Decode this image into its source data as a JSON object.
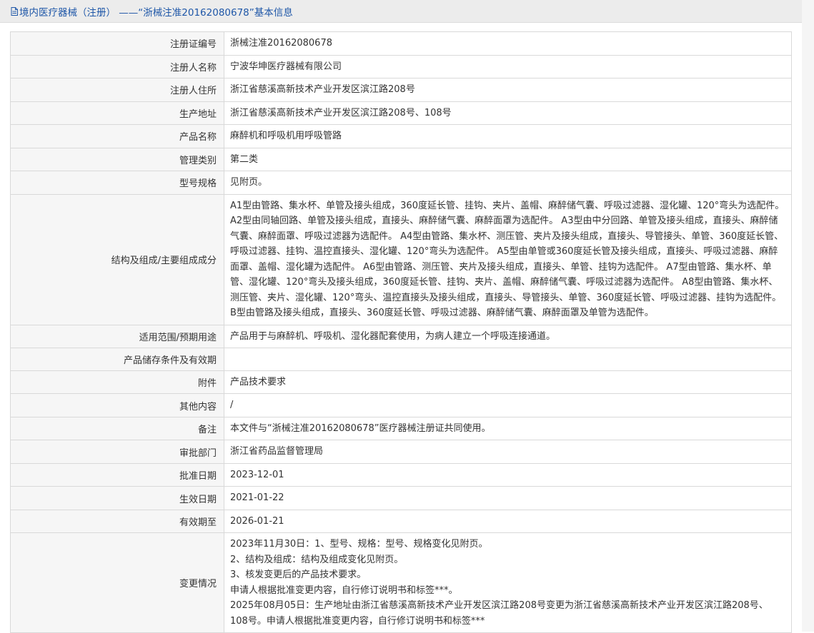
{
  "header": {
    "title": "境内医疗器械（注册） ——“浙械注准20162080678”基本信息"
  },
  "rows": [
    {
      "label": "注册证编号",
      "value": "浙械注准20162080678"
    },
    {
      "label": "注册人名称",
      "value": "宁波华坤医疗器械有限公司"
    },
    {
      "label": "注册人住所",
      "value": "浙江省慈溪高新技术产业开发区滨江路208号"
    },
    {
      "label": "生产地址",
      "value": "浙江省慈溪高新技术产业开发区滨江路208号、108号"
    },
    {
      "label": "产品名称",
      "value": "麻醉机和呼吸机用呼吸管路"
    },
    {
      "label": "管理类别",
      "value": "第二类"
    },
    {
      "label": "型号规格",
      "value": "见附页。"
    },
    {
      "label": "结构及组成/主要组成成分",
      "value": "A1型由管路、集水杯、单管及接头组成，360度延长管、挂钩、夹片、盖帽、麻醉储气囊、呼吸过滤器、湿化罐、120°弯头为选配件。 A2型由同轴回路、单管及接头组成，直接头、麻醉储气囊、麻醉面罩为选配件。 A3型由中分回路、单管及接头组成，直接头、麻醉储气囊、麻醉面罩、呼吸过滤器为选配件。 A4型由管路、集水杯、测压管、夹片及接头组成，直接头、导管接头、单管、360度延长管、呼吸过滤器、挂钩、温控直接头、湿化罐、120°弯头为选配件。 A5型由单管或360度延长管及接头组成，直接头、呼吸过滤器、麻醉面罩、盖帽、湿化罐为选配件。 A6型由管路、测压管、夹片及接头组成，直接头、单管、挂钩为选配件。 A7型由管路、集水杯、单管、湿化罐、120°弯头及接头组成，360度延长管、挂钩、夹片、盖帽、麻醉储气囊、呼吸过滤器为选配件。 A8型由管路、集水杯、测压管、夹片、湿化罐、120°弯头、温控直接头及接头组成，直接头、导管接头、单管、360度延长管、呼吸过滤器、挂钩为选配件。 B型由管路及接头组成，直接头、360度延长管、呼吸过滤器、麻醉储气囊、麻醉面罩及单管为选配件。"
    },
    {
      "label": "适用范围/预期用途",
      "value": "产品用于与麻醉机、呼吸机、湿化器配套使用，为病人建立一个呼吸连接通道。"
    },
    {
      "label": "产品储存条件及有效期",
      "value": ""
    },
    {
      "label": "附件",
      "value": "产品技术要求"
    },
    {
      "label": "其他内容",
      "value": "/"
    },
    {
      "label": "备注",
      "value": "本文件与“浙械注准20162080678”医疗器械注册证共同使用。"
    },
    {
      "label": "审批部门",
      "value": "浙江省药品监督管理局"
    },
    {
      "label": "批准日期",
      "value": "2023-12-01"
    },
    {
      "label": "生效日期",
      "value": "2021-01-22"
    },
    {
      "label": "有效期至",
      "value": "2026-01-21"
    }
  ],
  "change_row": {
    "label": "变更情况",
    "lines": [
      "2023年11月30日：1、型号、规格：型号、规格变化见附页。",
      "2、结构及组成：结构及组成变化见附页。",
      "3、核发变更后的产品技术要求。",
      "申请人根据批准变更内容，自行修订说明书和标签***。",
      "2025年08月05日：生产地址由浙江省慈溪高新技术产业开发区滨江路208号变更为浙江省慈溪高新技术产业开发区滨江路208号、108号。申请人根据批准变更内容，自行修订说明书和标签***"
    ]
  },
  "colors": {
    "title": "#1f57a8",
    "label_bg": "#f6f6f6",
    "border": "#d9d9d9",
    "header_bg": "#ececec"
  },
  "icons": {
    "header_icon": "document-icon"
  }
}
